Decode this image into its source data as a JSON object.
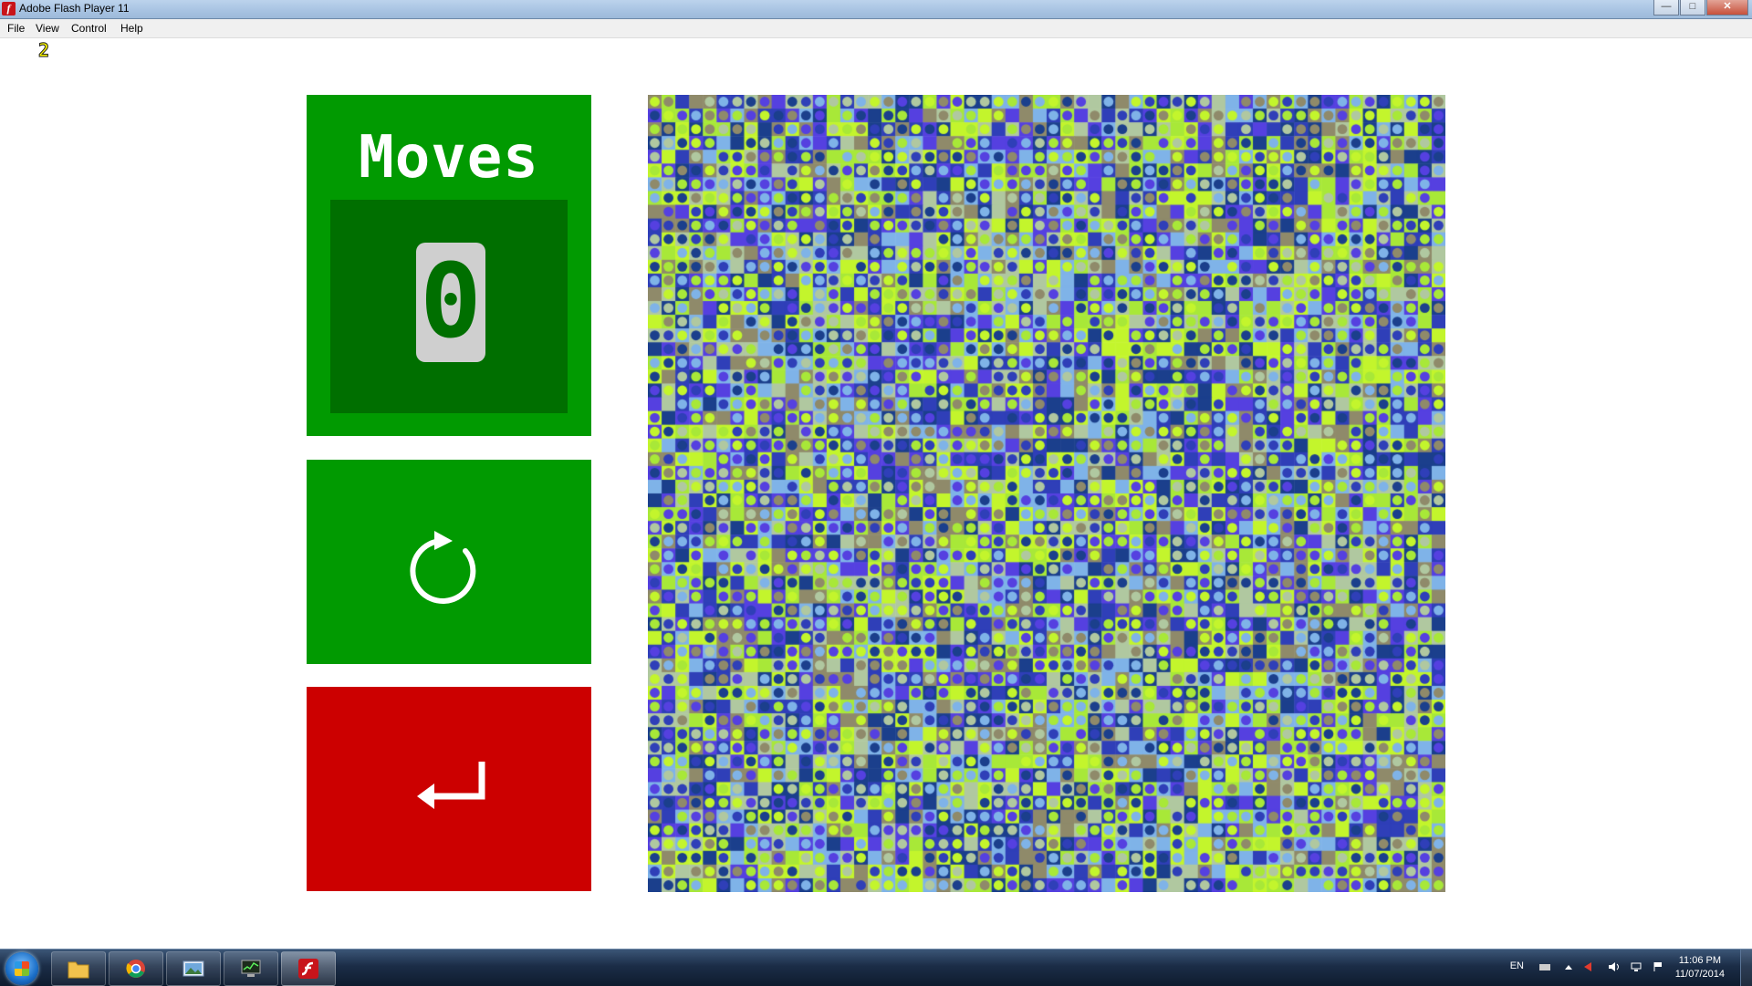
{
  "window": {
    "title": "Adobe Flash Player 11",
    "app_icon": "flash-icon",
    "controls": [
      "minimize-icon",
      "maximize-icon",
      "close-icon"
    ]
  },
  "menu": [
    {
      "label": "File"
    },
    {
      "label": "View"
    },
    {
      "label": "Control"
    },
    {
      "label": "Help"
    }
  ],
  "overlay": {
    "fps_counter": "2"
  },
  "game": {
    "moves_label": "Moves",
    "moves_value": "0",
    "restart_icon": "restart-arrow-icon",
    "back_icon": "return-arrow-icon",
    "colors": {
      "panel_green": "#019a01",
      "panel_dark_green": "#006f00",
      "panel_red": "#cc0000",
      "digit_bg": "#cfcfcf"
    },
    "board": {
      "columns": 58,
      "rows": 58,
      "palette": [
        "#c3f52c",
        "#2f3fb8",
        "#5540e0",
        "#1b3f8c",
        "#7fb3e8",
        "#8f8a6a",
        "#b0c8a0",
        "#a8e838"
      ]
    }
  },
  "taskbar": {
    "apps": [
      {
        "name": "explorer",
        "icon": "folder-icon"
      },
      {
        "name": "chrome",
        "icon": "chrome-icon"
      },
      {
        "name": "picture-viewer",
        "icon": "picture-icon"
      },
      {
        "name": "task-manager",
        "icon": "monitor-icon"
      },
      {
        "name": "flash-player",
        "icon": "flash-icon",
        "active": true
      }
    ],
    "tray": {
      "language": "EN",
      "time": "11:06 PM",
      "date": "11/07/2014"
    }
  }
}
